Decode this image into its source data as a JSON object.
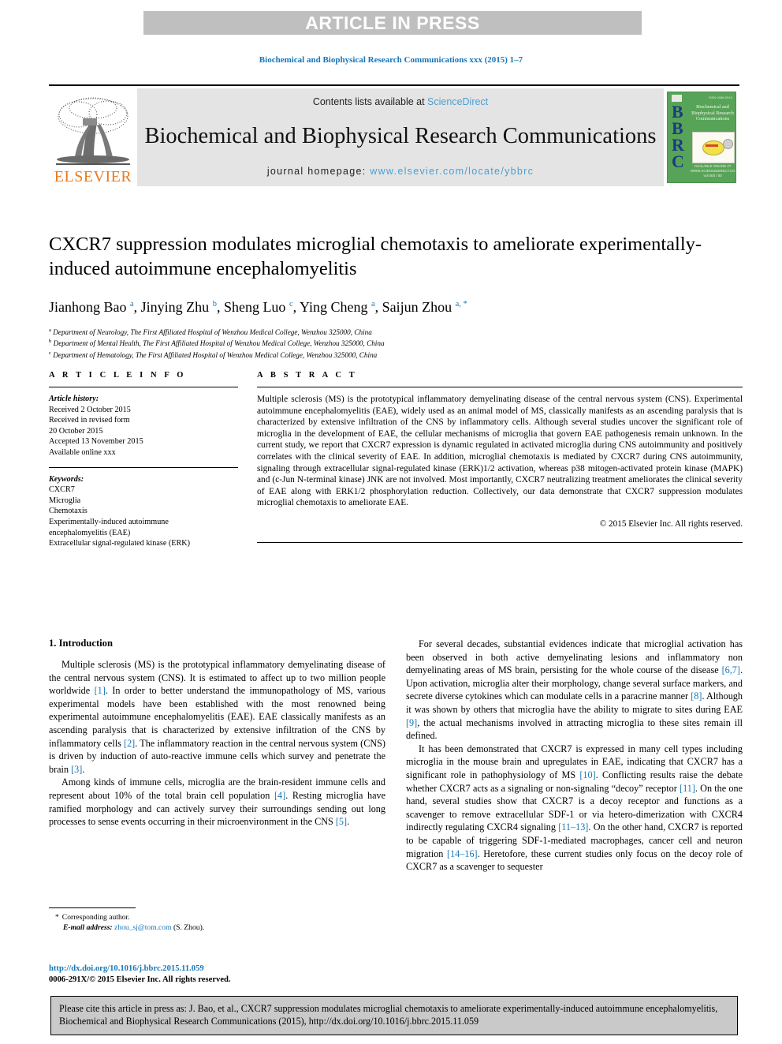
{
  "banner": {
    "text": "ARTICLE IN PRESS"
  },
  "running_head": "Biochemical and Biophysical Research Communications xxx (2015) 1–7",
  "masthead": {
    "contents_prefix": "Contents lists available at ",
    "sciencedirect": "ScienceDirect",
    "journal_title": "Biochemical and Biophysical Research Communications",
    "homepage_prefix": "journal homepage: ",
    "homepage_url": "www.elsevier.com/locate/ybbrc",
    "elsevier_wordmark": "ELSEVIER",
    "cover": {
      "letters": "B\nB\nR\nC",
      "title": "Biochemical and Biophysical Research Communications",
      "issn": "ISSN 0006-291X",
      "footer": "AVAILABLE ONLINE AT WWW.SCIENCEDIRECT.COM\nVol 000 / 00"
    }
  },
  "article": {
    "title": "CXCR7 suppression modulates microglial chemotaxis to ameliorate experimentally-induced autoimmune encephalomyelitis",
    "authors_html": "Jianhong Bao <sup class=\"aff-mark\">a</sup>, Jinying Zhu <sup class=\"aff-mark\">b</sup>, Sheng Luo <sup class=\"aff-mark\">c</sup>, Ying Cheng <sup class=\"aff-mark\">a</sup>, Saijun Zhou <sup class=\"aff-mark\">a, *</sup>",
    "affiliations": [
      {
        "key": "a",
        "text": "Department of Neurology, The First Affiliated Hospital of Wenzhou Medical College, Wenzhou 325000, China"
      },
      {
        "key": "b",
        "text": "Department of Mental Health, The First Affiliated Hospital of Wenzhou Medical College, Wenzhou 325000, China"
      },
      {
        "key": "c",
        "text": "Department of Hematology, The First Affiliated Hospital of Wenzhou Medical College, Wenzhou 325000, China"
      }
    ]
  },
  "article_info": {
    "heading": "A R T I C L E  I N F O",
    "history_label": "Article history:",
    "history_lines": [
      "Received 2 October 2015",
      "Received in revised form",
      "20 October 2015",
      "Accepted 13 November 2015",
      "Available online xxx"
    ],
    "keywords_label": "Keywords:",
    "keywords": [
      "CXCR7",
      "Microglia",
      "Chemotaxis",
      "Experimentally-induced autoimmune",
      "encephalomyelitis (EAE)",
      "Extracellular signal-regulated kinase (ERK)"
    ]
  },
  "abstract": {
    "heading": "A B S T R A C T",
    "text": "Multiple sclerosis (MS) is the prototypical inflammatory demyelinating disease of the central nervous system (CNS). Experimental autoimmune encephalomyelitis (EAE), widely used as an animal model of MS, classically manifests as an ascending paralysis that is characterized by extensive infiltration of the CNS by inflammatory cells. Although several studies uncover the significant role of microglia in the development of EAE, the cellular mechanisms of microglia that govern EAE pathogenesis remain unknown. In the current study, we report that CXCR7 expression is dynamic regulated in activated microglia during CNS autoimmunity and positively correlates with the clinical severity of EAE. In addition, microglial chemotaxis is mediated by CXCR7 during CNS autoimmunity, signaling through extracellular signal-regulated kinase (ERK)1/2 activation, whereas p38 mitogen-activated protein kinase (MAPK) and (c-Jun N-terminal kinase) JNK are not involved. Most importantly, CXCR7 neutralizing treatment ameliorates the clinical severity of EAE along with ERK1/2 phosphorylation reduction. Collectively, our data demonstrate that CXCR7 suppression modulates microglial chemotaxis to ameliorate EAE.",
    "copyright": "© 2015 Elsevier Inc. All rights reserved."
  },
  "introduction": {
    "heading": "1.  Introduction",
    "left_paragraphs": [
      "Multiple sclerosis (MS) is the prototypical inflammatory demyelinating disease of the central nervous system (CNS). It is estimated to affect up to two million people worldwide [1]. In order to better understand the immunopathology of MS, various experimental models have been established with the most renowned being experimental autoimmune encephalomyelitis (EAE). EAE classically manifests as an ascending paralysis that is characterized by extensive infiltration of the CNS by inflammatory cells [2]. The inflammatory reaction in the central nervous system (CNS) is driven by induction of auto-reactive immune cells which survey and penetrate the brain [3].",
      "Among kinds of immune cells, microglia are the brain-resident immune cells and represent about 10% of the total brain cell population [4]. Resting microglia have ramified morphology and can actively survey their surroundings sending out long processes to sense events occurring in their microenvironment in the CNS [5]."
    ],
    "right_paragraphs": [
      "For several decades, substantial evidences indicate that microglial activation has been observed in both active demyelinating lesions and inflammatory non demyelinating areas of MS brain, persisting for the whole course of the disease [6,7]. Upon activation, microglia alter their morphology, change several surface markers, and secrete diverse cytokines which can modulate cells in a paracrine manner [8]. Although it was shown by others that microglia have the ability to migrate to sites during EAE [9], the actual mechanisms involved in attracting microglia to these sites remain ill defined.",
      "It has been demonstrated that CXCR7 is expressed in many cell types including microglia in the mouse brain and upregulates in EAE, indicating that CXCR7 has a significant role in pathophysiology of MS [10]. Conflicting results raise the debate whether CXCR7 acts as a signaling or non-signaling “decoy” receptor [11]. On the one hand, several studies show that CXCR7 is a decoy receptor and functions as a scavenger to remove extracellular SDF-1 or via hetero-dimerization with CXCR4 indirectly regulating CXCR4 signaling [11–13]. On the other hand, CXCR7 is reported to be capable of triggering SDF-1-mediated macrophages, cancer cell and neuron migration [14–16]. Heretofore, these current studies only focus on the decoy role of CXCR7 as a scavenger to sequester"
    ]
  },
  "footer": {
    "corresponding_star": "*",
    "corresponding_label": "Corresponding author.",
    "email_label": "E-mail address:",
    "email": "zhou_sj@tom.com",
    "email_suffix": "(S. Zhou).",
    "doi": "http://dx.doi.org/10.1016/j.bbrc.2015.11.059",
    "issn_copyright": "0006-291X/© 2015 Elsevier Inc. All rights reserved."
  },
  "citation_box": {
    "text": "Please cite this article in press as: J. Bao, et al., CXCR7 suppression modulates microglial chemotaxis to ameliorate experimentally-induced autoimmune encephalomyelitis, Biochemical and Biophysical Research Communications (2015), http://dx.doi.org/10.1016/j.bbrc.2015.11.059"
  },
  "colors": {
    "banner_bg": "#bfbfbf",
    "link_blue": "#1676b6",
    "sciencedirect_blue": "#4b9fd5",
    "elsevier_orange": "#e87b1e",
    "cover_green": "#57a357",
    "cover_letter_blue": "#1a3b82",
    "masthead_bg": "#e4e4e4",
    "citation_bg": "#c9c9c9"
  }
}
